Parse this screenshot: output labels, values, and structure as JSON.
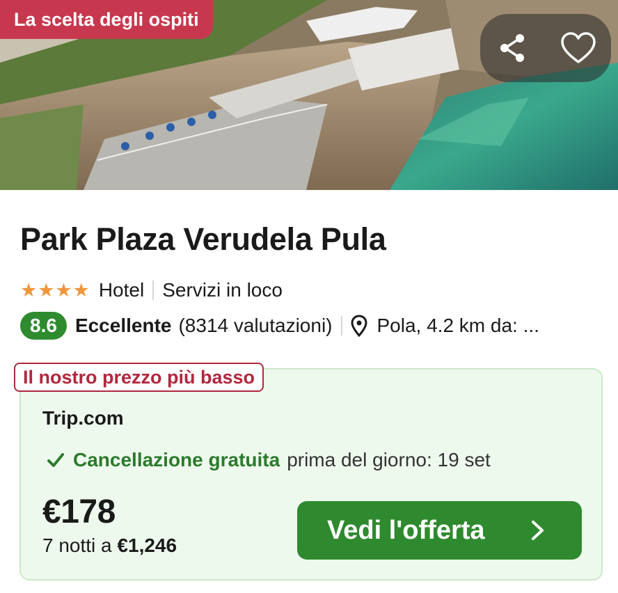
{
  "hero": {
    "badge": "La scelta degli ospiti",
    "share_icon": "share-icon",
    "favorite_icon": "heart-icon"
  },
  "hotel": {
    "name": "Park Plaza Verudela Pula",
    "stars": 4,
    "stars_text": "★★★★",
    "type": "Hotel",
    "amenities": "Servizi in loco",
    "score": "8.6",
    "rating_label": "Eccellente",
    "reviews": "(8314 valutazioni)",
    "location": "Pola, 4.2 km da: ..."
  },
  "offer": {
    "tag": "Il nostro prezzo più basso",
    "provider": "Trip.com",
    "cancellation": "Cancellazione gratuita",
    "cancellation_detail": "prima del giorno: 19 set",
    "price": "€178",
    "nights_prefix": "7 notti a",
    "total": "€1,246",
    "cta_label": "Vedi l'offerta"
  },
  "colors": {
    "badge_red": "#c7384f",
    "tag_red": "#b0283f",
    "green": "#2f8a2f",
    "star_orange": "#f0963c",
    "offer_bg": "#eef9ee"
  }
}
